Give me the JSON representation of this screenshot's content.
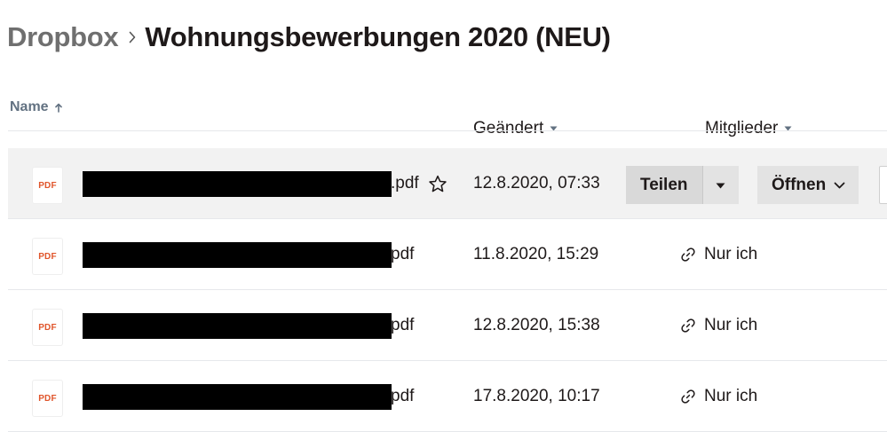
{
  "breadcrumb": {
    "root": "Dropbox",
    "current": "Wohnungsbewerbungen 2020 (NEU)"
  },
  "columns": {
    "name": "Name",
    "modified": "Geändert",
    "members": "Mitglieder"
  },
  "rows": [
    {
      "icon_label": "PDF",
      "ext": ".pdf",
      "modified": "12.8.2020, 07:33",
      "actions": {
        "share": "Teilen",
        "open": "Öffnen"
      }
    },
    {
      "icon_label": "PDF",
      "ext": "pdf",
      "modified": "11.8.2020, 15:29",
      "members": "Nur ich"
    },
    {
      "icon_label": "PDF",
      "ext": "pdf",
      "modified": "12.8.2020, 15:38",
      "members": "Nur ich"
    },
    {
      "icon_label": "PDF",
      "ext": "pdf",
      "modified": "17.8.2020, 10:17",
      "members": "Nur ich"
    }
  ],
  "colors": {
    "pdf_accent": "#e0552b",
    "header_text": "#637282",
    "hover_row": "#f2f2f2"
  },
  "icons": {
    "breadcrumb_separator": "chevron-right-icon",
    "name_sort": "arrow-up-icon",
    "column_menu": "caret-down-icon",
    "favorite": "star-outline-icon",
    "shared_link": "link-icon"
  }
}
